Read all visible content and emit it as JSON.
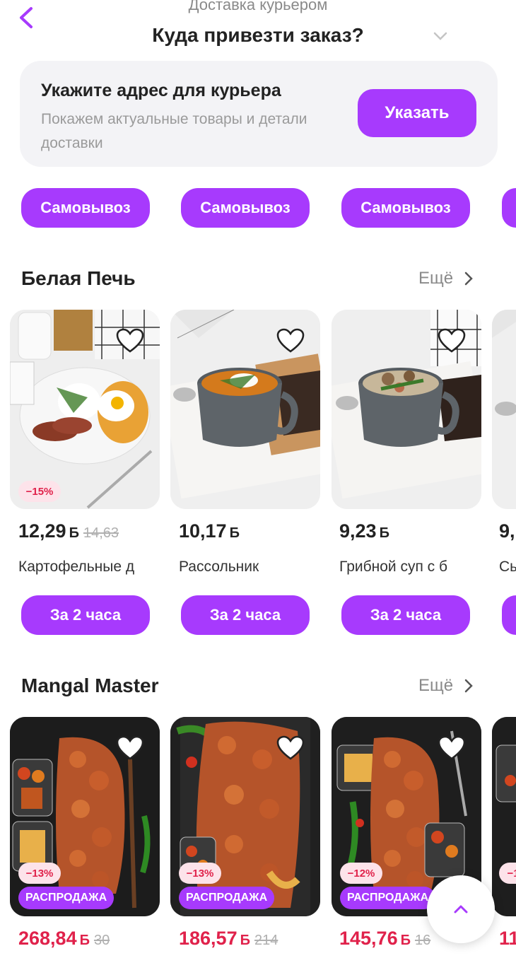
{
  "header": {
    "subtitle": "Доставка курьером",
    "title": "Куда привезти заказ?"
  },
  "address_card": {
    "title": "Укажите адрес для курьера",
    "description": "Покажем актуальные товары и детали доставки",
    "button_label": "Указать"
  },
  "pickup_pills": [
    "Самовывоз",
    "Самовывоз",
    "Самовывоз"
  ],
  "sections": [
    {
      "title": "Белая Печь",
      "more_label": "Ещё",
      "products": [
        {
          "price": "12,29",
          "currency": "Б",
          "old_price": "14,63",
          "name": "Картофельные д",
          "discount": "−15%",
          "button": "За 2 часа"
        },
        {
          "price": "10,17",
          "currency": "Б",
          "old_price": "",
          "name": "Рассольник",
          "discount": "",
          "button": "За 2 часа"
        },
        {
          "price": "9,23",
          "currency": "Б",
          "old_price": "",
          "name": "Грибной суп с б",
          "discount": "",
          "button": "За 2 часа"
        },
        {
          "price": "9,",
          "currency": "",
          "old_price": "",
          "name": "Сы",
          "discount": "",
          "button": ""
        }
      ]
    },
    {
      "title": "Mangal Master",
      "more_label": "Ещё",
      "products": [
        {
          "price": "268,84",
          "currency": "Б",
          "old_price": "30",
          "discount": "−13%",
          "badge": "РАСПРОДАЖА"
        },
        {
          "price": "186,57",
          "currency": "Б",
          "old_price": "214",
          "discount": "−13%",
          "badge": "РАСПРОДАЖА"
        },
        {
          "price": "145,76",
          "currency": "Б",
          "old_price": "16",
          "discount": "−12%",
          "badge": "РАСПРОДАЖА"
        },
        {
          "price": "11",
          "currency": "",
          "old_price": "",
          "discount": "−1",
          "badge": ""
        }
      ]
    }
  ],
  "colors": {
    "accent": "#a73afd",
    "sale_red": "#e0224b",
    "card_bg": "#f3f3f6"
  },
  "icons": {
    "back": "chevron-left-icon",
    "favorite": "heart-icon",
    "more": "chevron-right-icon",
    "scroll_top": "chevron-up-icon"
  }
}
